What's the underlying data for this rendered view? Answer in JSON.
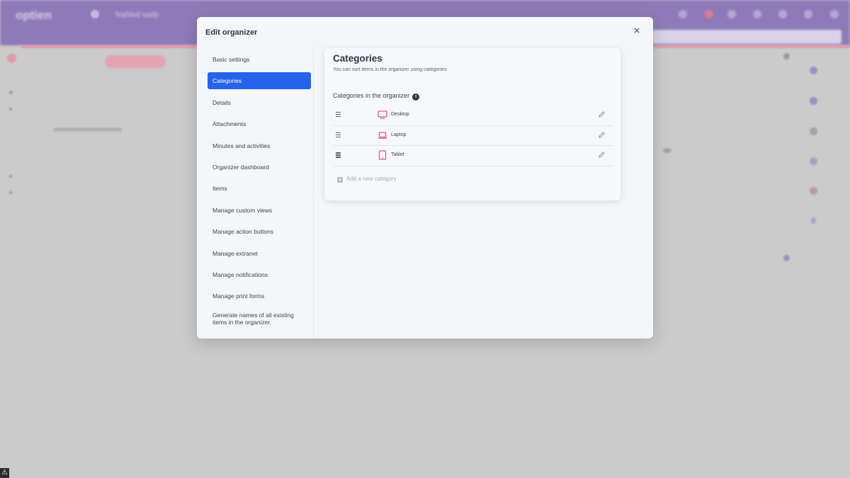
{
  "background_app": {
    "logo": "optien",
    "title": "Nahled sady"
  },
  "modal": {
    "title": "Edit organizer",
    "close_label": "×"
  },
  "nav": {
    "items": [
      {
        "label": "Basic settings",
        "active": false
      },
      {
        "label": "Categories",
        "active": true
      },
      {
        "label": "Details",
        "active": false
      },
      {
        "label": "Attachments",
        "active": false
      },
      {
        "label": "Minutes and activities",
        "active": false
      },
      {
        "label": "Organizer dashboard",
        "active": false
      },
      {
        "label": "Items",
        "active": false
      },
      {
        "label": "Manage custom views",
        "active": false
      },
      {
        "label": "Manage action buttons",
        "active": false
      },
      {
        "label": "Manage extranet",
        "active": false
      },
      {
        "label": "Manage notifications",
        "active": false
      },
      {
        "label": "Manage print forms",
        "active": false
      },
      {
        "label": "Generate names of all existing items in the organizer.",
        "active": false
      }
    ]
  },
  "categories": {
    "title": "Categories",
    "subtitle": "You can sort items in the organizer using categories",
    "section_title": "Categories in the organizer",
    "info_icon": "i",
    "items": [
      {
        "name": "Desktop",
        "icon": "desktop-icon"
      },
      {
        "name": "Laptop",
        "icon": "laptop-icon"
      },
      {
        "name": "Tablet",
        "icon": "tablet-icon"
      }
    ],
    "add_label": "Add a new category",
    "add_icon": "+"
  },
  "colors": {
    "accent": "#2563eb",
    "category_icon": "#e05a74",
    "topbar": "#8e7ab8"
  }
}
